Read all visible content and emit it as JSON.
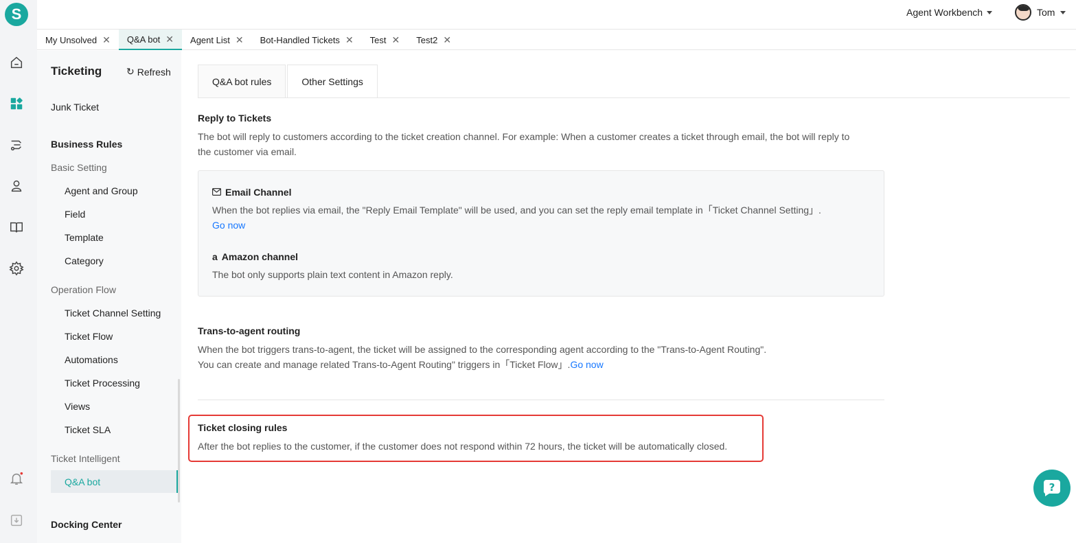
{
  "app": {
    "logo_letter": "S"
  },
  "rail": {
    "icons": [
      "home-icon",
      "apps-icon",
      "routing-icon",
      "contacts-icon",
      "book-icon",
      "gear-icon",
      "bell-icon",
      "download-icon"
    ]
  },
  "header": {
    "workbench": "Agent Workbench",
    "user_name": "Tom"
  },
  "tabs": [
    {
      "label": "My Unsolved"
    },
    {
      "label": "Q&A bot",
      "active": true
    },
    {
      "label": "Agent List"
    },
    {
      "label": "Bot-Handled Tickets"
    },
    {
      "label": "Test"
    },
    {
      "label": "Test2"
    }
  ],
  "sidebar": {
    "title": "Ticketing",
    "refresh": "Refresh",
    "junk": "Junk Ticket",
    "business_rules": "Business Rules",
    "basic_setting": "Basic Setting",
    "basic_items": [
      "Agent and Group",
      "Field",
      "Template",
      "Category"
    ],
    "operation_flow": "Operation Flow",
    "operation_items": [
      "Ticket Channel Setting",
      "Ticket Flow",
      "Automations",
      "Ticket Processing",
      "Views",
      "Ticket SLA"
    ],
    "ticket_intelligent": "Ticket Intelligent",
    "qa_bot": "Q&A bot",
    "docking_center": "Docking Center"
  },
  "main": {
    "tabs": [
      "Q&A bot rules",
      "Other Settings"
    ],
    "active_tab": "Other Settings",
    "reply": {
      "title": "Reply to Tickets",
      "desc_line1": "The bot will reply to customers according to the ticket creation channel. For example: When a customer creates a ticket through email, the bot will reply to",
      "desc_line2": "the customer via email.",
      "email_title": "Email Channel",
      "email_desc": "When the bot replies via email, the \"Reply Email Template\" will be used, and you can set the reply email template in「Ticket Channel Setting」.",
      "email_link": "Go now",
      "amazon_title": "Amazon channel",
      "amazon_desc": "The bot only supports plain text content in Amazon reply."
    },
    "routing": {
      "title": "Trans-to-agent routing",
      "line1": "When the bot triggers trans-to-agent, the ticket will be assigned to the corresponding agent according to the \"Trans-to-Agent Routing\".",
      "line2": "You can create and manage related Trans-to-Agent Routing\" triggers in「Ticket Flow」.",
      "link": "Go now"
    },
    "closing": {
      "title": "Ticket closing rules",
      "desc": "After the bot replies to the customer, if the customer does not respond within 72 hours, the ticket will be automatically closed."
    }
  },
  "colors": {
    "accent": "#1aa89f",
    "link": "#1677ff",
    "highlight": "#e53935"
  }
}
